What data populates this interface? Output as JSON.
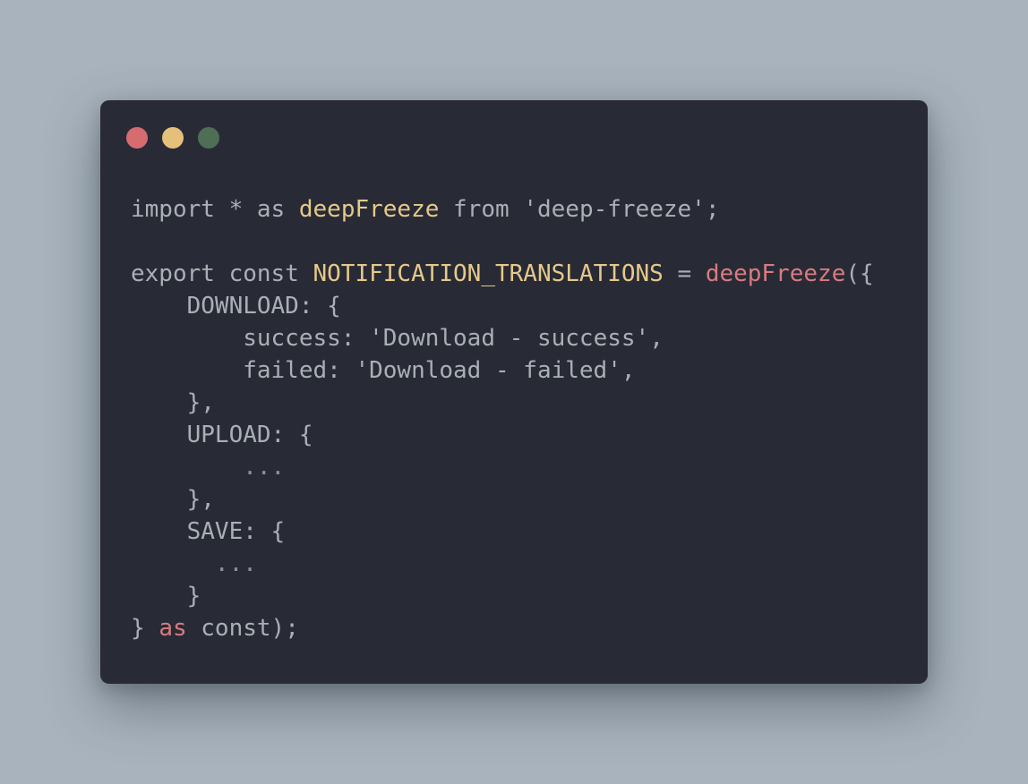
{
  "colors": {
    "background": "#a8b3bd",
    "window": "#282b35",
    "close": "#d66b70",
    "minimize": "#e5c07b",
    "maximize": "#4e6e55",
    "text": "#a9b0b5",
    "identifier": "#e6c88b",
    "function": "#d97b80"
  },
  "window_controls": {
    "close": "close-icon",
    "minimize": "minimize-icon",
    "maximize": "maximize-icon"
  },
  "code": {
    "line1": {
      "import": "import",
      "star": " * ",
      "as": "as ",
      "name": "deepFreeze",
      "from": " from ",
      "module": "'deep-freeze'",
      "end": ";"
    },
    "line3": {
      "export": "export",
      "const": " const ",
      "name": "NOTIFICATION_TRANSLATIONS",
      "eq": " = ",
      "fn": "deepFreeze",
      "open": "({"
    },
    "line4": "    DOWNLOAD: {",
    "line5": {
      "key": "        success: ",
      "value": "'Download - success'",
      "end": ","
    },
    "line6": {
      "key": "        failed: ",
      "value": "'Download - failed'",
      "end": ","
    },
    "line7": "    },",
    "line8": "    UPLOAD: {",
    "line9": "        ...",
    "line10": "    },",
    "line11": "    SAVE: {",
    "line12": "      ...",
    "line13": "    }",
    "line14": {
      "close": "} ",
      "as": "as",
      "rest": " const);"
    }
  }
}
